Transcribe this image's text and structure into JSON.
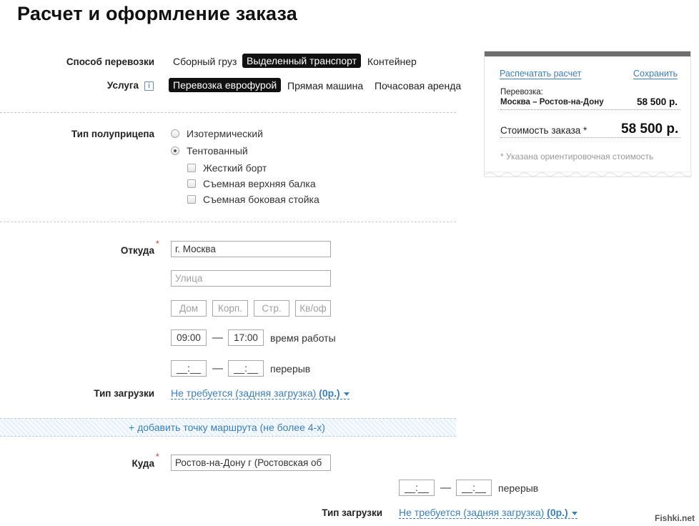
{
  "page": {
    "title": "Расчет и оформление заказа"
  },
  "transport": {
    "label": "Способ перевозки",
    "options": [
      "Сборный груз",
      "Выделенный транспорт",
      "Контейнер"
    ],
    "selected": "Выделенный транспорт"
  },
  "service": {
    "label": "Услуга",
    "info_icon": "i",
    "options": [
      "Перевозка еврофурой",
      "Прямая машина",
      "Почасовая аренда"
    ],
    "selected": "Перевозка еврофурой"
  },
  "trailer": {
    "label": "Тип полуприцепа",
    "radios": [
      {
        "label": "Изотермический",
        "checked": false
      },
      {
        "label": "Тентованный",
        "checked": true
      }
    ],
    "checks": [
      {
        "label": "Жесткий борт",
        "checked": false
      },
      {
        "label": "Съемная верхняя балка",
        "checked": false
      },
      {
        "label": "Съемная боковая стойка",
        "checked": false
      }
    ]
  },
  "from": {
    "label": "Откуда",
    "required_mark": "*",
    "city_value": "г. Москва",
    "street_placeholder": "Улица",
    "house_placeholder": "Дом",
    "korp_placeholder": "Корп.",
    "str_placeholder": "Стр.",
    "apt_placeholder": "Кв/оф",
    "work_from": "09:00",
    "work_to": "17:00",
    "dash": "—",
    "work_label": "время работы",
    "break_from": "__:__",
    "break_to": "__:__",
    "break_label": "перерыв",
    "loading_label": "Тип загрузки",
    "loading_value": "Не требуется (задняя загрузка)",
    "loading_price": "(0р.)"
  },
  "add_route": {
    "label": "+ добавить точку маршрута (не более 4-х)"
  },
  "to": {
    "label": "Куда",
    "required_mark": "*",
    "city_value": "Ростов-на-Дону г (Ростовская об",
    "break_from": "__:__",
    "break_to": "__:__",
    "dash": "—",
    "break_label": "перерыв",
    "loading_label": "Тип загрузки",
    "loading_value": "Не требуется (задняя загрузка)",
    "loading_price": "(0р.)"
  },
  "summary": {
    "print_link": "Распечатать расчет",
    "save_link": "Сохранить",
    "transport_label": "Перевозка:",
    "route": "Москва – Ростов-на-Дону",
    "route_price": "58 500 р.",
    "total_label": "Стоимость заказа *",
    "total_price": "58 500 р.",
    "note": "* Указана ориентировочная стоимость"
  },
  "watermark": "Fishki.net",
  "colors": {
    "link": "#3a7fbf",
    "selected_bg": "#111111",
    "card_top": "#6f6f6f"
  }
}
